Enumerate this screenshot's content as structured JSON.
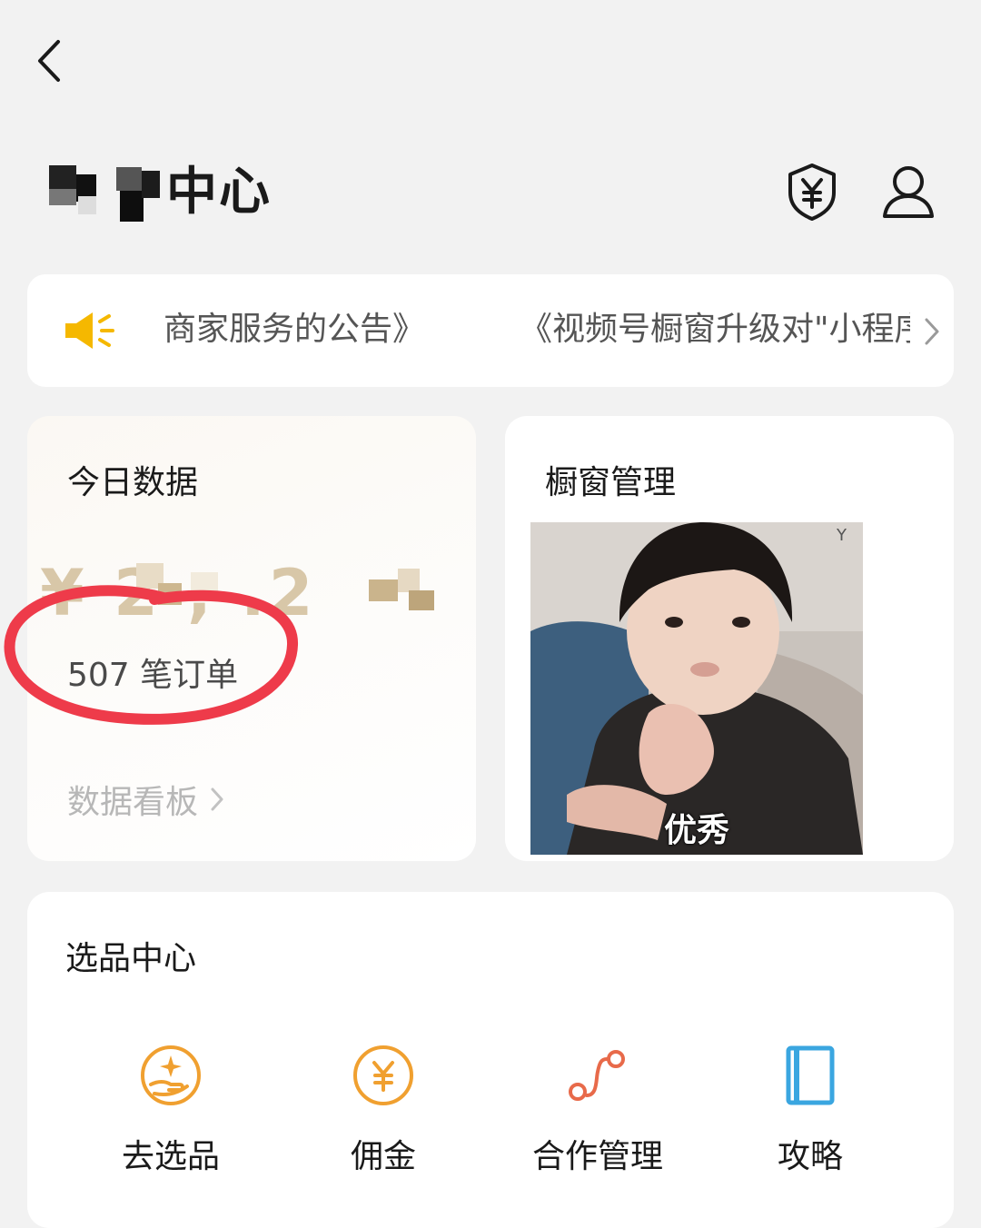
{
  "header": {
    "title_visible": "中心",
    "back_icon": "chevron-left-icon",
    "shield_icon": "shield-yen-icon",
    "user_icon": "user-icon"
  },
  "notice": {
    "text_left": "商家服务的公告》",
    "text_right": "《视频号橱窗升级对\"小程序",
    "icon": "speaker-icon",
    "accent": "#f5b800"
  },
  "today": {
    "title": "今日数据",
    "amount": "¥ 2 ,  .2",
    "orders": "507 笔订单",
    "dashboard_link": "数据看板"
  },
  "window": {
    "title": "橱窗管理",
    "caption": "优秀",
    "watermark": "Y"
  },
  "select": {
    "title": "选品中心",
    "tools": [
      {
        "label": "去选品",
        "icon": "hand-star-icon",
        "color": "#f0a030"
      },
      {
        "label": "佣金",
        "icon": "yen-coin-icon",
        "color": "#f0a030"
      },
      {
        "label": "合作管理",
        "icon": "route-icon",
        "color": "#e86a4a"
      },
      {
        "label": "攻略",
        "icon": "book-icon",
        "color": "#3aa6e0"
      }
    ]
  },
  "colors": {
    "background": "#f2f2f2",
    "amount": "#d8c7a8",
    "annotation": "#ee3b4a"
  }
}
